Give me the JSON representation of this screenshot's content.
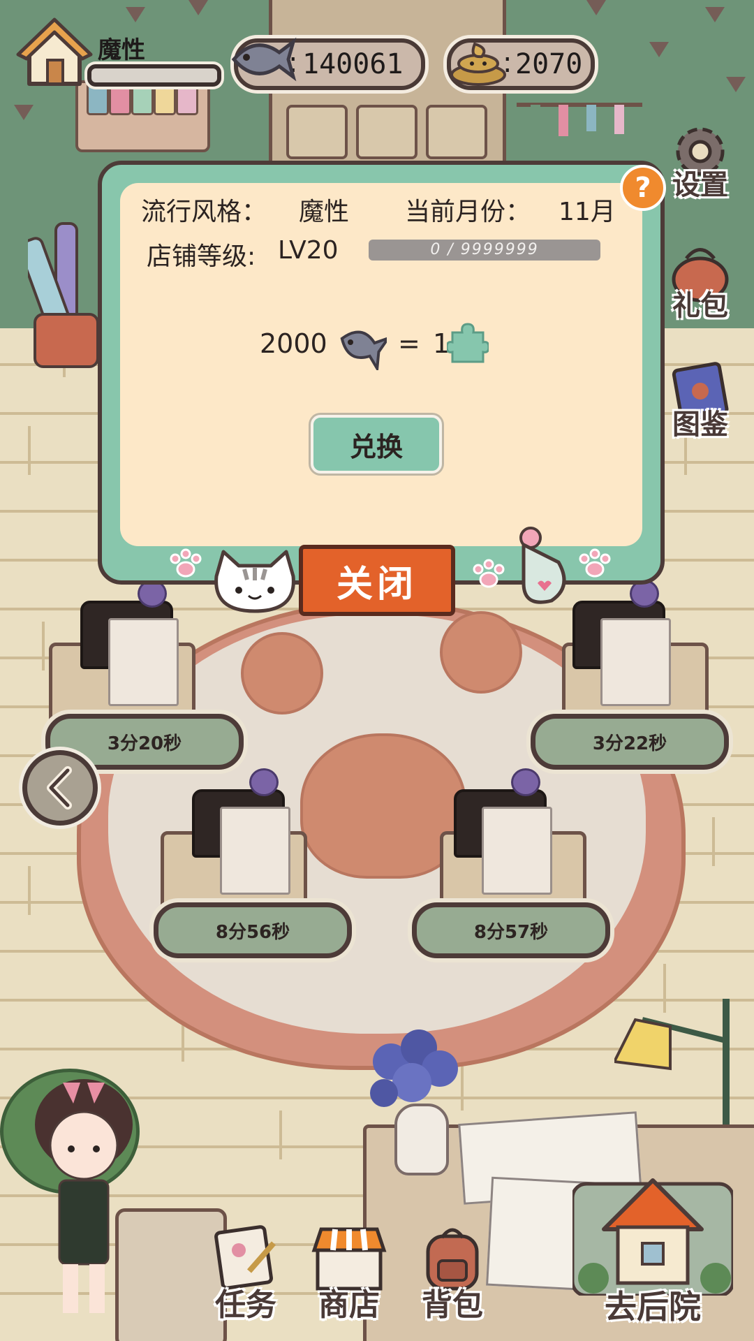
{
  "hud": {
    "style_name": "魔性",
    "style_progress": 0,
    "fish_count": "140061",
    "poop_count": "2070",
    "colon": ":"
  },
  "side_buttons": {
    "settings": "设置",
    "gift": "礼包",
    "catalog": "图鉴"
  },
  "modal": {
    "help": "?",
    "popular_style_label": "流行风格：",
    "popular_style_value": "魔性",
    "current_month_label": "当前月份：",
    "current_month_value": "11月",
    "shop_level_label": "店铺等级:",
    "shop_level_value": "LV20",
    "level_progress_text": "0 / 9999999",
    "level_progress": 0,
    "exchange_fish": "2000",
    "exchange_equals": "=",
    "exchange_pieces": "1",
    "exchange_button": "兑换",
    "close_button": "关闭"
  },
  "timers": [
    {
      "label": "3分20秒"
    },
    {
      "label": "3分22秒"
    },
    {
      "label": "8分56秒"
    },
    {
      "label": "8分57秒"
    }
  ],
  "nav": {
    "tasks": "任务",
    "shop": "商店",
    "backpack": "背包",
    "backyard": "去后院"
  },
  "colors": {
    "modal_frame": "#88c6ac",
    "modal_body": "#fde8c8",
    "close_button": "#e3622a",
    "help_button": "#f08a2e",
    "timer_pill": "#97ab92",
    "wall_green": "#6e9478"
  }
}
